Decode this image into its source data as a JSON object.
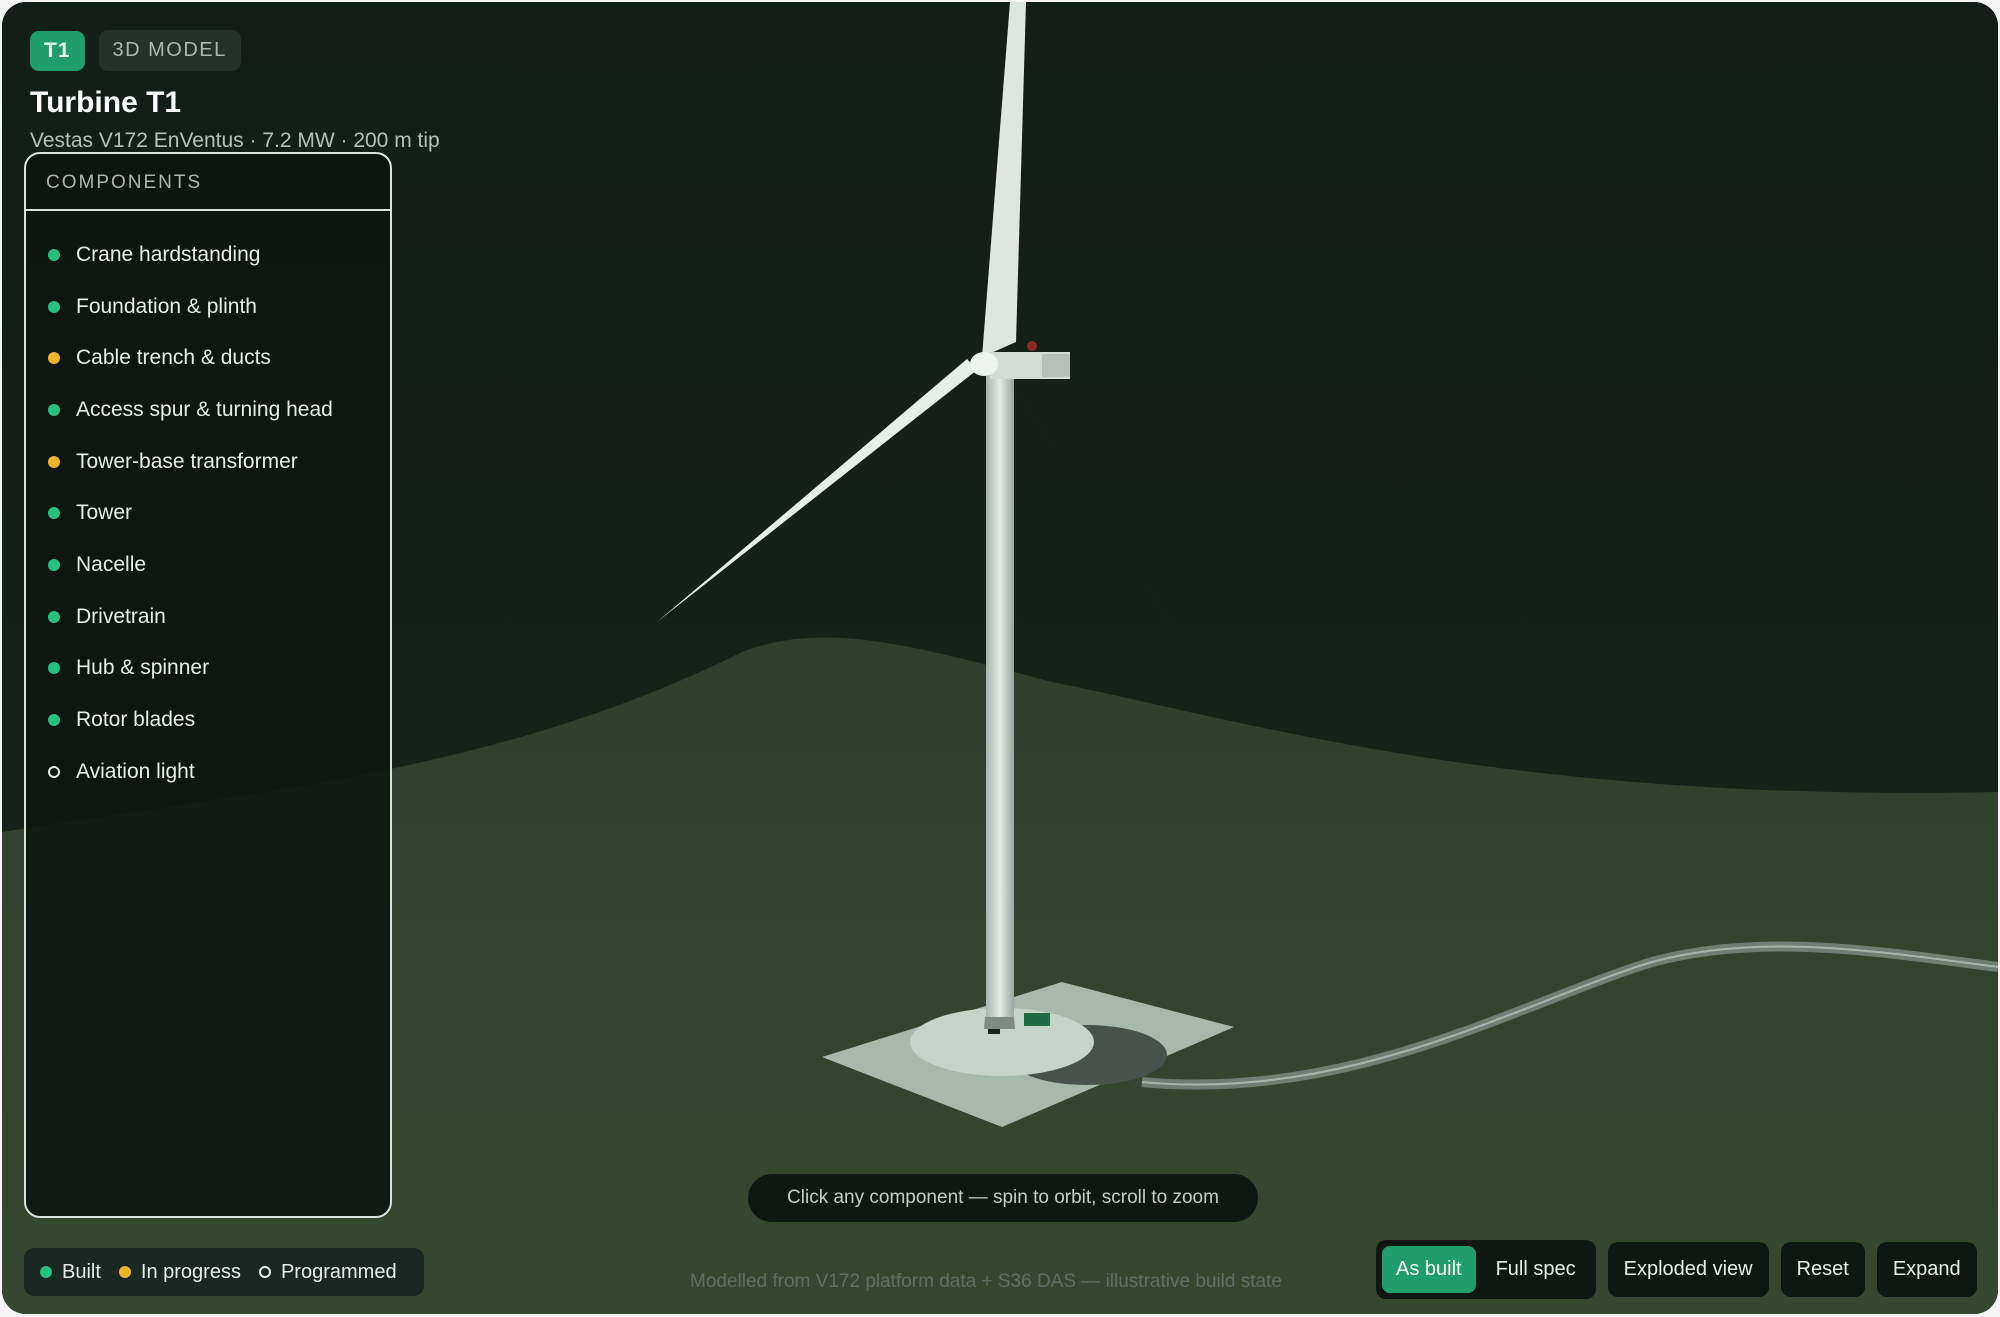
{
  "header": {
    "badge_id": "T1",
    "badge_type": "3D MODEL",
    "title": "Turbine T1",
    "subtitle": "Vestas V172 EnVentus · 7.2 MW · 200 m tip"
  },
  "components": {
    "heading": "COMPONENTS",
    "items": [
      {
        "label": "Crane hardstanding",
        "status": "built"
      },
      {
        "label": "Foundation & plinth",
        "status": "built"
      },
      {
        "label": "Cable trench & ducts",
        "status": "in-progress"
      },
      {
        "label": "Access spur & turning head",
        "status": "built"
      },
      {
        "label": "Tower-base transformer",
        "status": "in-progress"
      },
      {
        "label": "Tower",
        "status": "built"
      },
      {
        "label": "Nacelle",
        "status": "built"
      },
      {
        "label": "Drivetrain",
        "status": "built"
      },
      {
        "label": "Hub & spinner",
        "status": "built"
      },
      {
        "label": "Rotor blades",
        "status": "built"
      },
      {
        "label": "Aviation light",
        "status": "programmed"
      }
    ]
  },
  "legend": {
    "built": "Built",
    "in_progress": "In progress",
    "programmed": "Programmed"
  },
  "hint": "Click any component — spin to orbit, scroll to zoom",
  "footnote": "Modelled from V172 platform data + S36 DAS — illustrative build state",
  "controls": {
    "as_built": "As built",
    "full_spec": "Full spec",
    "exploded": "Exploded view",
    "reset": "Reset",
    "expand": "Expand",
    "active_mode": "As built"
  },
  "colors": {
    "built": "#27c07f",
    "in_progress": "#f0b429",
    "accent": "#1f9e6c",
    "sky": "#132019",
    "ground": "#34432f"
  }
}
